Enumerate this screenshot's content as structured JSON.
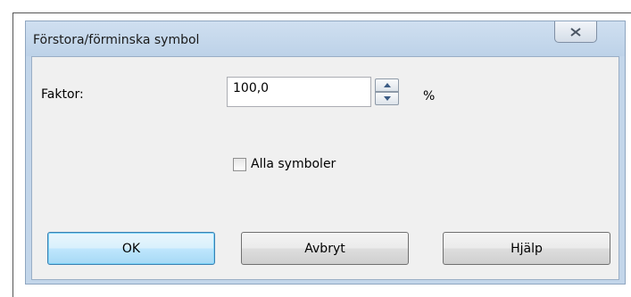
{
  "dialog": {
    "title": "Förstora/förminska symbol",
    "close_icon": "close-x-icon"
  },
  "factor": {
    "label": "Faktor:",
    "value": "100,0",
    "unit": "%",
    "spin_up_icon": "arrow-up-icon",
    "spin_down_icon": "arrow-down-icon"
  },
  "all_symbols": {
    "label": "Alla symboler",
    "checked": false
  },
  "buttons": {
    "ok": "OK",
    "cancel": "Avbryt",
    "help": "Hjälp"
  },
  "colors": {
    "title_bar": "#c3d6ea",
    "client_area": "#f0f0f0",
    "default_button_border": "#3c7fb1"
  }
}
